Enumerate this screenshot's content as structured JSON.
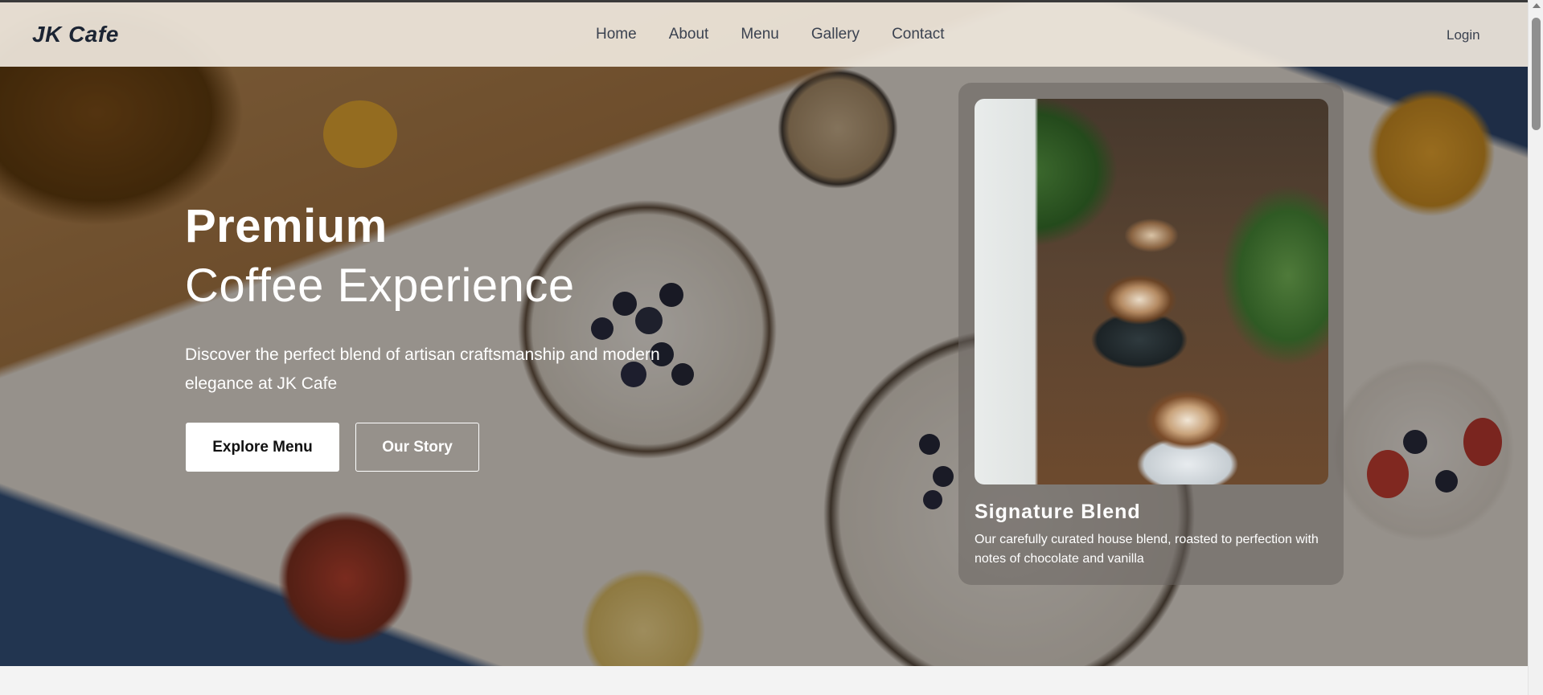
{
  "header": {
    "logo": "JK Cafe",
    "nav": [
      "Home",
      "About",
      "Menu",
      "Gallery",
      "Contact"
    ],
    "login": "Login"
  },
  "hero": {
    "title_line1": "Premium",
    "title_line2": "Coffee Experience",
    "lead": "Discover the perfect blend of artisan craftsmanship and modern elegance at JK Cafe",
    "primary_button": "Explore Menu",
    "secondary_button": "Our Story"
  },
  "feature_card": {
    "title": "Signature Blend",
    "description": "Our carefully curated house blend, roasted to perfection with notes of chocolate and vanilla",
    "image_alt": "latte art coffee cups with plants"
  },
  "colors": {
    "nav_bg": "#ece4da",
    "logo_text": "#1b2433",
    "link_text": "#3b4250",
    "button_primary_bg": "#ffffff",
    "page_bg": "#f3f3f3"
  },
  "icons": {
    "scroll_up": "chevron-up-icon"
  }
}
